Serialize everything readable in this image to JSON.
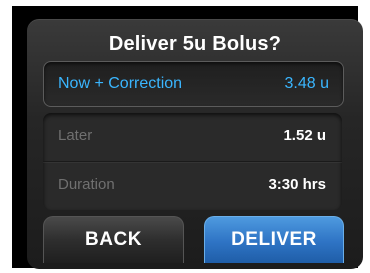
{
  "dialog": {
    "title": "Deliver 5u Bolus?",
    "now": {
      "label": "Now + Correction",
      "value": "3.48 u"
    },
    "later": {
      "label": "Later",
      "value": "1.52 u"
    },
    "duration": {
      "label": "Duration",
      "value": "3:30 hrs"
    },
    "buttons": {
      "back_label": "BACK",
      "deliver_label": "DELIVER"
    }
  },
  "colors": {
    "accent_blue": "#3ab6ff",
    "deliver_button": "#2e73c4"
  }
}
